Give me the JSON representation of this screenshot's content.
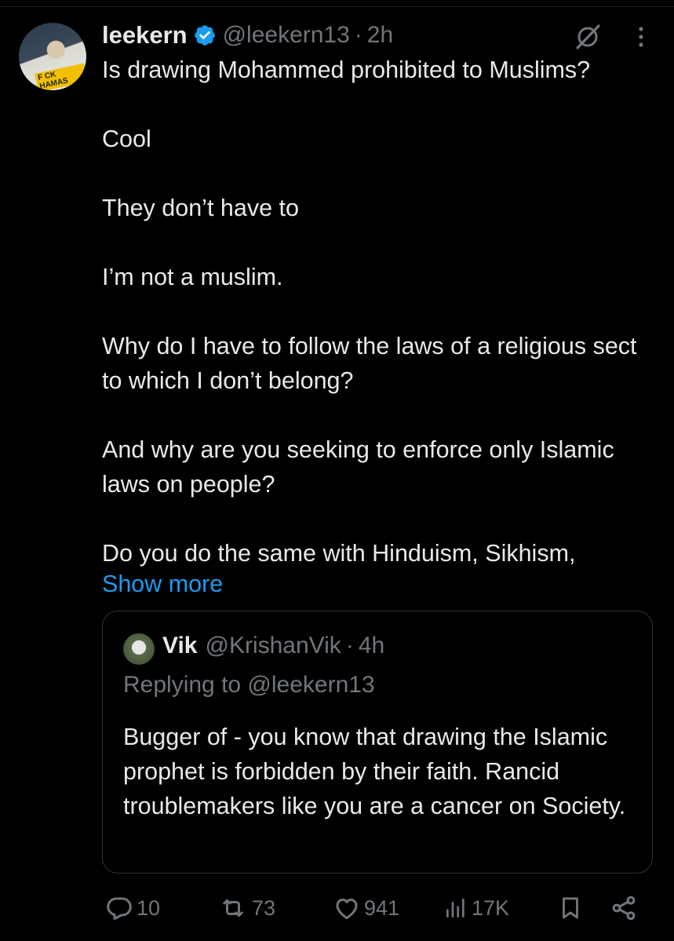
{
  "post": {
    "display_name": "leekern",
    "handle": "@leekern13",
    "separator": "·",
    "time": "2h",
    "avatar_shirt_text": "F CK HAMAS",
    "paragraphs": [
      "Is drawing Mohammed prohibited to Muslims?",
      "Cool",
      "They don’t have to",
      "I’m not a muslim.",
      "Why do I have to follow the laws of a religious sect to which I don’t belong?",
      "And why are you seeking to enforce only Islamic laws on people?",
      "Do you do the same with Hinduism, Sikhism,"
    ],
    "show_more": "Show more",
    "icons": {
      "verified": "verified-badge-icon",
      "grok": "grok-icon",
      "more": "more-vertical-icon"
    }
  },
  "quote": {
    "display_name": "Vik",
    "handle": "@KrishanVik",
    "separator": "·",
    "time": "4h",
    "replying_to": "Replying to @leekern13",
    "text": "Bugger of - you know that drawing the Islamic prophet is forbidden by their faith. Rancid troublemakers like you are a cancer on Society."
  },
  "actions": {
    "replies": "10",
    "reposts": "73",
    "likes": "941",
    "views": "17K",
    "icons": [
      "reply-icon",
      "repost-icon",
      "like-icon",
      "views-icon",
      "bookmark-icon",
      "share-icon"
    ]
  },
  "colors": {
    "background": "#000000",
    "text": "#e7e9ea",
    "muted": "#71767b",
    "link": "#1d9bf0",
    "verified": "#1d9bf0",
    "border": "#2f3336"
  }
}
